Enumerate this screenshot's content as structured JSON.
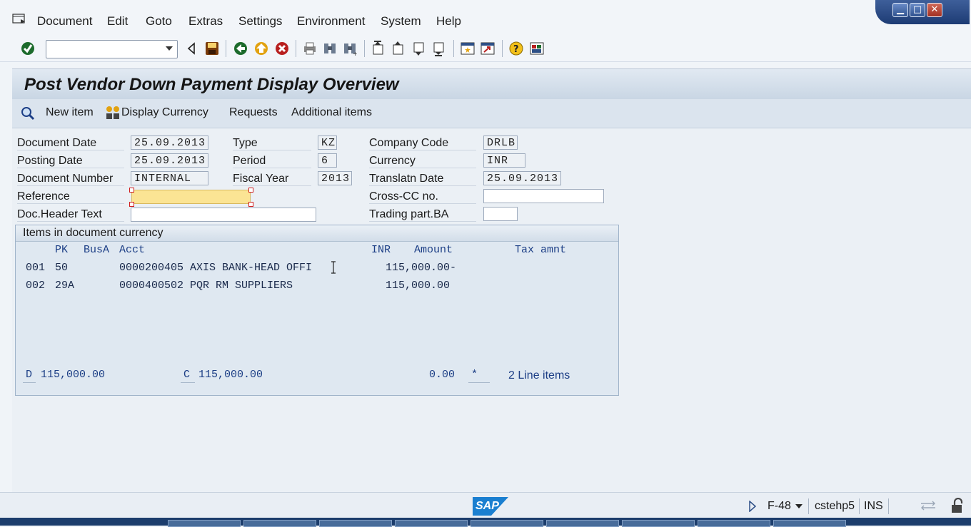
{
  "menu": [
    "Document",
    "Edit",
    "Goto",
    "Extras",
    "Settings",
    "Environment",
    "System",
    "Help"
  ],
  "window_controls": {
    "minimize": "▁",
    "maximize": "□",
    "close": "✕"
  },
  "command_field": {
    "value": ""
  },
  "title": "Post Vendor Down Payment Display Overview",
  "app_toolbar": {
    "new_item": "New item",
    "display_currency": "Display Currency",
    "requests": "Requests",
    "additional_items": "Additional items"
  },
  "header": {
    "document_date": {
      "label": "Document Date",
      "value": "25.09.2013"
    },
    "posting_date": {
      "label": "Posting Date",
      "value": "25.09.2013"
    },
    "document_number": {
      "label": "Document Number",
      "value": "INTERNAL"
    },
    "reference": {
      "label": "Reference",
      "value": ""
    },
    "doc_header_text": {
      "label": "Doc.Header Text",
      "value": ""
    },
    "type": {
      "label": "Type",
      "value": "KZ"
    },
    "period": {
      "label": "Period",
      "value": "6"
    },
    "fiscal_year": {
      "label": "Fiscal Year",
      "value": "2013"
    },
    "company_code": {
      "label": "Company Code",
      "value": "DRLB"
    },
    "currency": {
      "label": "Currency",
      "value": "INR"
    },
    "translatn_date": {
      "label": "Translatn Date",
      "value": "25.09.2013"
    },
    "cross_cc": {
      "label": "Cross-CC no.",
      "value": ""
    },
    "trading_part": {
      "label": "Trading part.BA",
      "value": ""
    }
  },
  "items": {
    "title": "Items in document currency",
    "columns": {
      "pk": "PK",
      "busa": "BusA",
      "acct": "Acct",
      "currency": "INR",
      "amount": "Amount",
      "tax": "Tax amnt"
    },
    "rows": [
      {
        "no": "001",
        "pk": "50",
        "acct": "0000200405 AXIS BANK-HEAD OFFI",
        "amount": "115,000.00-"
      },
      {
        "no": "002",
        "pk": "29A",
        "acct": "0000400502 PQR RM SUPPLIERS",
        "amount": "115,000.00"
      }
    ],
    "totals": {
      "d_label": "D",
      "debit": "115,000.00",
      "c_label": "C",
      "credit": "115,000.00",
      "balance": "0.00",
      "star": "*",
      "line_items": "2 Line items"
    }
  },
  "status": {
    "transaction": "F-48",
    "server": "cstehp5",
    "mode": "INS",
    "logo": "SAP"
  },
  "colors": {
    "title_bg": "#c9d6e4",
    "reference_field": "#fbe494",
    "sap_logo": "#1a7fd0"
  }
}
